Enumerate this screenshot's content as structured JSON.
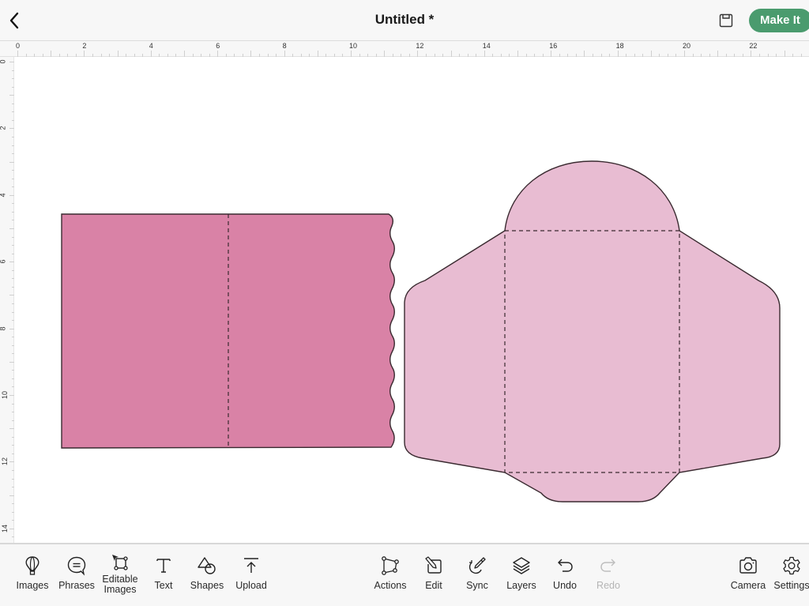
{
  "header": {
    "title": "Untitled *",
    "back_icon": "chevron-left-icon",
    "save_icon": "save-icon",
    "make_it_label": "Make It",
    "accent_color": "#4a9b6e"
  },
  "rulers": {
    "horizontal_labels": [
      "0",
      "2",
      "4",
      "6",
      "8",
      "10",
      "12",
      "14",
      "16",
      "18",
      "20",
      "22"
    ],
    "vertical_labels": [
      "0",
      "2",
      "4",
      "6",
      "8",
      "10",
      "12",
      "14"
    ]
  },
  "canvas": {
    "shapes": [
      {
        "name": "card-with-scalloped-edge",
        "fill": "#d982a6",
        "stroke": "#3a2a30",
        "score_line": "vertical-center"
      },
      {
        "name": "envelope-template",
        "fill": "#e8bcd2",
        "stroke": "#3a2a30",
        "score_line": "center-rectangle"
      }
    ]
  },
  "toolbar": {
    "left": [
      {
        "label": "Images",
        "icon": "hot-air-balloon-icon"
      },
      {
        "label": "Phrases",
        "icon": "speech-bubble-icon"
      },
      {
        "label": "Editable\nImages",
        "icon": "editable-images-icon"
      },
      {
        "label": "Text",
        "icon": "text-icon"
      },
      {
        "label": "Shapes",
        "icon": "shapes-icon"
      },
      {
        "label": "Upload",
        "icon": "upload-icon"
      }
    ],
    "center": [
      {
        "label": "Actions",
        "icon": "actions-icon"
      },
      {
        "label": "Edit",
        "icon": "edit-icon"
      },
      {
        "label": "Sync",
        "icon": "sync-color-icon"
      },
      {
        "label": "Layers",
        "icon": "layers-icon"
      },
      {
        "label": "Undo",
        "icon": "undo-icon"
      },
      {
        "label": "Redo",
        "icon": "redo-icon",
        "disabled": true
      }
    ],
    "right": [
      {
        "label": "Camera",
        "icon": "camera-icon"
      },
      {
        "label": "Settings",
        "icon": "gear-icon"
      }
    ]
  }
}
